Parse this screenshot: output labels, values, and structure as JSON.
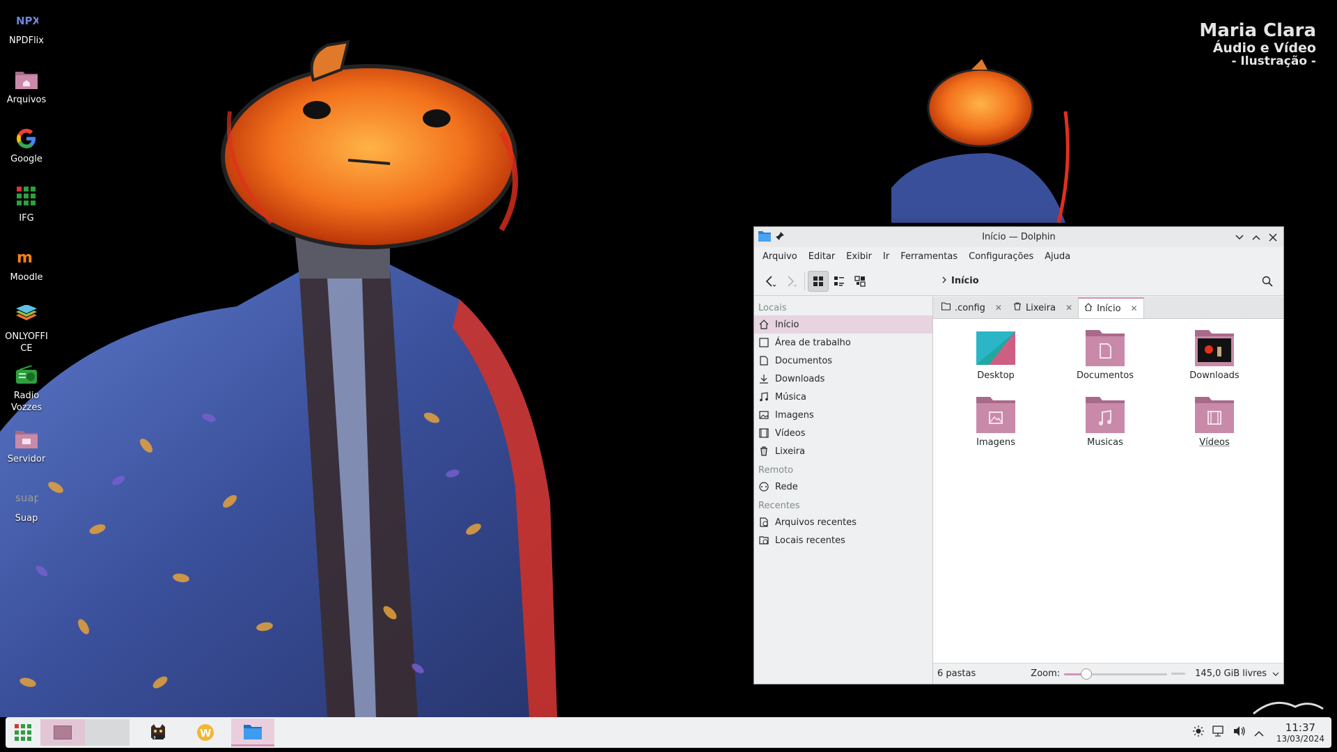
{
  "wallpaper": {
    "credit_name": "Maria Clara",
    "credit_line2": "Áudio e Vídeo",
    "credit_line3": "- Ilustração -"
  },
  "desktop": {
    "icons": [
      {
        "label": "NPDFlix",
        "icon": "npdflix-icon"
      },
      {
        "label": "Arquivos",
        "icon": "folder-home-icon"
      },
      {
        "label": "Google",
        "icon": "google-icon"
      },
      {
        "label": "IFG",
        "icon": "ifg-icon"
      },
      {
        "label": "Moodle",
        "icon": "moodle-icon"
      },
      {
        "label": "ONLYOFFICE",
        "icon": "onlyoffice-icon"
      },
      {
        "label": "Radio Vozzes",
        "icon": "radio-icon"
      },
      {
        "label": "Servidor",
        "icon": "server-folder-icon"
      },
      {
        "label": "Suap",
        "icon": "suap-icon"
      }
    ]
  },
  "dolphin": {
    "title": "Início — Dolphin",
    "menu": [
      "Arquivo",
      "Editar",
      "Exibir",
      "Ir",
      "Ferramentas",
      "Configurações",
      "Ajuda"
    ],
    "breadcrumb": "Início",
    "places": {
      "header_locais": "Locais",
      "locais": [
        {
          "label": "Início",
          "icon": "home-icon"
        },
        {
          "label": "Área de trabalho",
          "icon": "desktop-icon"
        },
        {
          "label": "Documentos",
          "icon": "document-icon"
        },
        {
          "label": "Downloads",
          "icon": "download-icon"
        },
        {
          "label": "Música",
          "icon": "music-icon"
        },
        {
          "label": "Imagens",
          "icon": "image-icon"
        },
        {
          "label": "Vídeos",
          "icon": "video-icon"
        },
        {
          "label": "Lixeira",
          "icon": "trash-icon"
        }
      ],
      "header_remoto": "Remoto",
      "remoto": [
        {
          "label": "Rede",
          "icon": "network-icon"
        }
      ],
      "header_recentes": "Recentes",
      "recentes": [
        {
          "label": "Arquivos recentes",
          "icon": "recent-files-icon"
        },
        {
          "label": "Locais recentes",
          "icon": "recent-places-icon"
        }
      ]
    },
    "tabs": [
      {
        "label": ".config",
        "icon": "folder-icon"
      },
      {
        "label": "Lixeira",
        "icon": "trash-icon"
      },
      {
        "label": "Início",
        "icon": "home-icon"
      }
    ],
    "files": [
      {
        "label": "Desktop",
        "icon": "desktop-folder-icon"
      },
      {
        "label": "Documentos",
        "icon": "documents-folder-icon"
      },
      {
        "label": "Downloads",
        "icon": "downloads-folder-icon"
      },
      {
        "label": "Imagens",
        "icon": "images-folder-icon"
      },
      {
        "label": "Musicas",
        "icon": "music-folder-icon"
      },
      {
        "label": "Vídeos",
        "icon": "videos-folder-icon"
      }
    ],
    "status": {
      "count": "6 pastas",
      "zoom_label": "Zoom:",
      "zoom_level": 0.18,
      "free_space": "145,0 GiB livres"
    }
  },
  "taskbar": {
    "time": "11:37",
    "date": "13/03/2024"
  },
  "colors": {
    "accent": "#d492b8",
    "folder": "#c98aa9",
    "folder_dark": "#a86a89"
  }
}
